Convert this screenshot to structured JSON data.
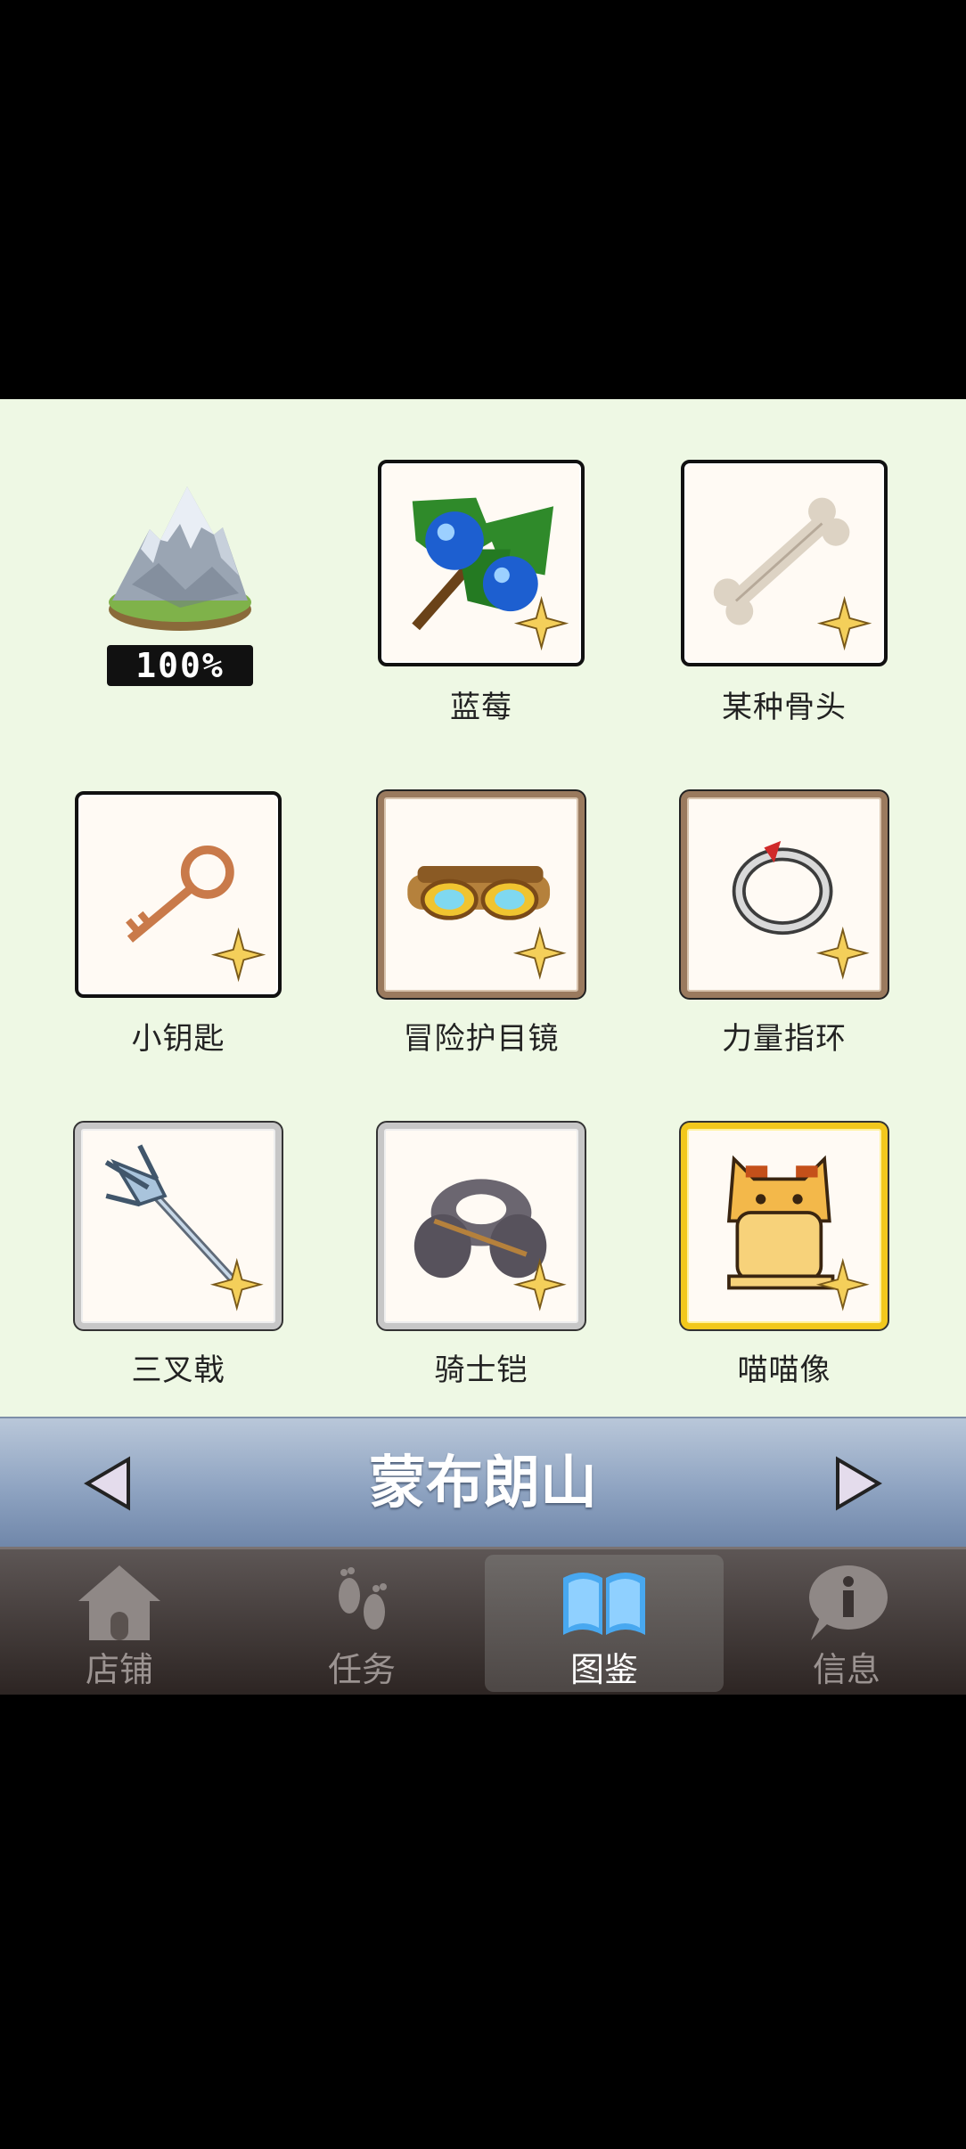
{
  "region": {
    "name": "蒙布朗山",
    "completion": "100%"
  },
  "items": [
    {
      "label": "蓝莓",
      "icon": "blueberry-icon",
      "frame": "plain"
    },
    {
      "label": "某种骨头",
      "icon": "bone-icon",
      "frame": "plain"
    },
    {
      "label": "小钥匙",
      "icon": "key-icon",
      "frame": "plain"
    },
    {
      "label": "冒险护目镜",
      "icon": "goggles-icon",
      "frame": "bronze"
    },
    {
      "label": "力量指环",
      "icon": "ring-icon",
      "frame": "bronze"
    },
    {
      "label": "三叉戟",
      "icon": "trident-icon",
      "frame": "silver"
    },
    {
      "label": "骑士铠",
      "icon": "armor-icon",
      "frame": "silver"
    },
    {
      "label": "喵喵像",
      "icon": "cat-statue-icon",
      "frame": "gold"
    }
  ],
  "tabs": [
    {
      "label": "店铺",
      "icon": "house-icon",
      "active": false
    },
    {
      "label": "任务",
      "icon": "footprints-icon",
      "active": false
    },
    {
      "label": "图鉴",
      "icon": "book-icon",
      "active": true
    },
    {
      "label": "信息",
      "icon": "info-icon",
      "active": false
    }
  ],
  "colors": {
    "panel_bg": "#eef8e4",
    "gold_frame": "#f2c81c",
    "bronze_frame": "#9a7a5e",
    "silver_frame": "#c7c7c7",
    "active_tab_text": "#ffffff"
  }
}
